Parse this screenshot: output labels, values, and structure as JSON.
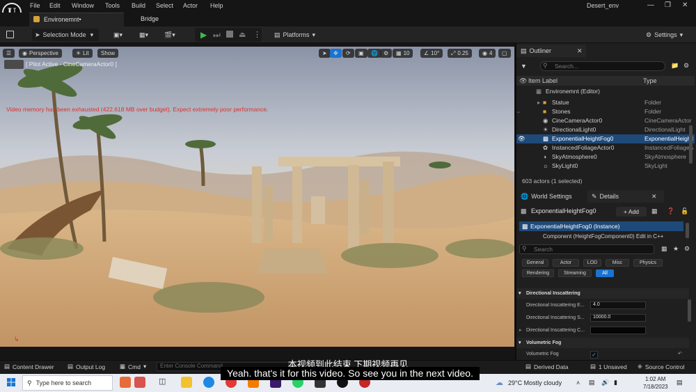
{
  "menu": {
    "items": [
      "File",
      "Edit",
      "Window",
      "Tools",
      "Build",
      "Select",
      "Actor",
      "Help"
    ]
  },
  "window": {
    "project": "Desert_env"
  },
  "tabs": [
    {
      "label": "Environemnt•"
    },
    {
      "label": "Bridge"
    }
  ],
  "toolbar": {
    "selection_mode": "Selection Mode",
    "platforms": "Platforms",
    "settings": "Settings"
  },
  "viewport": {
    "perspective": "Perspective",
    "lit": "Lit",
    "show": "Show",
    "grid_snap": "10",
    "rot_snap": "10°",
    "scale_snap": "0.25",
    "cam_speed": "4",
    "pilot": "[ Pilot Active - CineCameraActor0 ]",
    "warning": "Video memory has been exhausted (422.618 MB over budget). Expect extremely poor performance."
  },
  "outliner": {
    "title": "Outliner",
    "search_placeholder": "Search...",
    "col_label": "Item Label",
    "col_type": "Type",
    "rows": [
      {
        "label": "Environemnt (Editor)",
        "type": ""
      },
      {
        "label": "Statue",
        "type": "Folder"
      },
      {
        "label": "Stones",
        "type": "Folder"
      },
      {
        "label": "CineCameraActor0",
        "type": "CineCameraActor"
      },
      {
        "label": "DirectionalLight0",
        "type": "DirectionalLight"
      },
      {
        "label": "ExponentialHeightFog0",
        "type": "ExponentialHeightFog"
      },
      {
        "label": "InstancedFoliageActor0",
        "type": "InstancedFoliageActor"
      },
      {
        "label": "SkyAtmosphere0",
        "type": "SkyAtmosphere"
      },
      {
        "label": "SkyLight0",
        "type": "SkyLight"
      }
    ],
    "footer": "603 actors (1 selected)"
  },
  "details": {
    "tab_world": "World Settings",
    "tab_details": "Details",
    "object_name": "ExponentialHeightFog0",
    "add_label": "+ Add",
    "instance": "ExponentialHeightFog0 (Instance)",
    "component": "Component (HeightFogComponent0)   Edit in C++",
    "search_placeholder": "Search",
    "categories": [
      "General",
      "Actor",
      "LOD",
      "Misc",
      "Physics",
      "Rendering",
      "Streaming",
      "All"
    ],
    "sections": [
      {
        "title": "Directional Inscattering"
      },
      {
        "title": "Volumetric Fog"
      }
    ],
    "props": [
      {
        "label": "Directional Inscattering E...",
        "value": "4.0"
      },
      {
        "label": "Directional Inscattering S...",
        "value": "10000.0"
      },
      {
        "label": "Directional Inscattering C...",
        "value": ""
      },
      {
        "label": "Volumetric Fog",
        "value": "✓"
      }
    ]
  },
  "statusbar": {
    "content_drawer": "Content Drawer",
    "output_log": "Output Log",
    "cmd": "Cmd",
    "console_placeholder": "Enter Console Command",
    "derived_data": "Derived Data",
    "unsaved": "1 Unsaved",
    "source_control": "Source Control"
  },
  "subtitles": {
    "zh": "本视频到此结束 下期视频再见",
    "en": "Yeah. that's it for this video. So see you in the next video."
  },
  "taskbar": {
    "search_placeholder": "Type here to search",
    "weather": "29°C  Mostly cloudy",
    "time": "1:02 AM",
    "date": "7/18/2023"
  }
}
